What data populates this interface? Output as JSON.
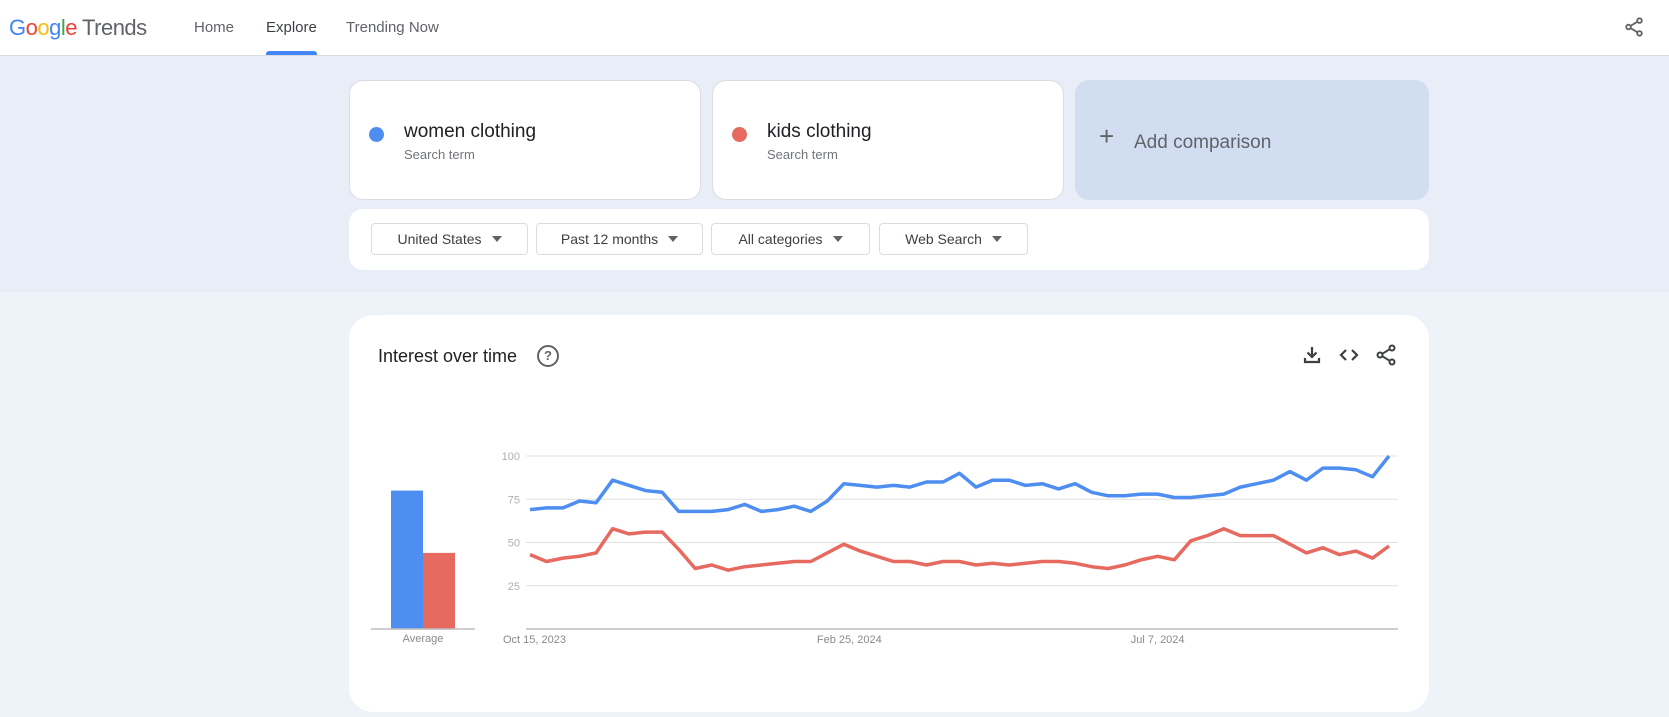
{
  "header": {
    "logo_google": [
      "G",
      "o",
      "o",
      "g",
      "l",
      "e"
    ],
    "logo_product": "Trends",
    "nav": [
      {
        "label": "Home",
        "active": false
      },
      {
        "label": "Explore",
        "active": true
      },
      {
        "label": "Trending Now",
        "active": false
      }
    ],
    "share_icon": "share-icon"
  },
  "terms": [
    {
      "name": "women clothing",
      "sub": "Search term",
      "color": "#4e8ef0"
    },
    {
      "name": "kids clothing",
      "sub": "Search term",
      "color": "#e66a60"
    }
  ],
  "add_comparison": {
    "icon": "+",
    "label": "Add comparison"
  },
  "filters": [
    {
      "label": "United States"
    },
    {
      "label": "Past 12 months"
    },
    {
      "label": "All categories"
    },
    {
      "label": "Web Search"
    }
  ],
  "card": {
    "title": "Interest over time",
    "help_icon": "?",
    "actions": [
      "download-icon",
      "embed-icon",
      "share-icon"
    ]
  },
  "chart_data": {
    "type": "line",
    "title": "Interest over time",
    "xlabel": "",
    "ylabel": "",
    "ylim": [
      0,
      100
    ],
    "yticks": [
      25,
      50,
      75,
      100
    ],
    "grid": true,
    "x_tick_labels": [
      {
        "label": "Oct 15, 2023",
        "index": 0
      },
      {
        "label": "Feb 25, 2024",
        "index": 19
      },
      {
        "label": "Jul 7, 2024",
        "index": 38
      }
    ],
    "series": [
      {
        "name": "women clothing",
        "color": "#4e8ef0",
        "values": [
          69,
          70,
          70,
          74,
          73,
          86,
          83,
          80,
          79,
          68,
          68,
          68,
          69,
          72,
          68,
          69,
          71,
          68,
          74,
          84,
          83,
          82,
          83,
          82,
          85,
          85,
          90,
          82,
          86,
          86,
          83,
          84,
          81,
          84,
          79,
          77,
          77,
          78,
          78,
          76,
          76,
          77,
          78,
          82,
          84,
          86,
          91,
          86,
          93,
          93,
          92,
          88,
          100
        ]
      },
      {
        "name": "kids clothing",
        "color": "#e66a60",
        "values": [
          43,
          39,
          41,
          42,
          44,
          58,
          55,
          56,
          56,
          46,
          35,
          37,
          34,
          36,
          37,
          38,
          39,
          39,
          44,
          49,
          45,
          42,
          39,
          39,
          37,
          39,
          39,
          37,
          38,
          37,
          38,
          39,
          39,
          38,
          36,
          35,
          37,
          40,
          42,
          40,
          51,
          54,
          58,
          54,
          54,
          54,
          49,
          44,
          47,
          43,
          45,
          41,
          48
        ]
      }
    ],
    "average": {
      "label": "Average",
      "values": [
        {
          "name": "women clothing",
          "value": 80,
          "color": "#4e8ef0"
        },
        {
          "name": "kids clothing",
          "value": 44,
          "color": "#e66a60"
        }
      ]
    }
  }
}
